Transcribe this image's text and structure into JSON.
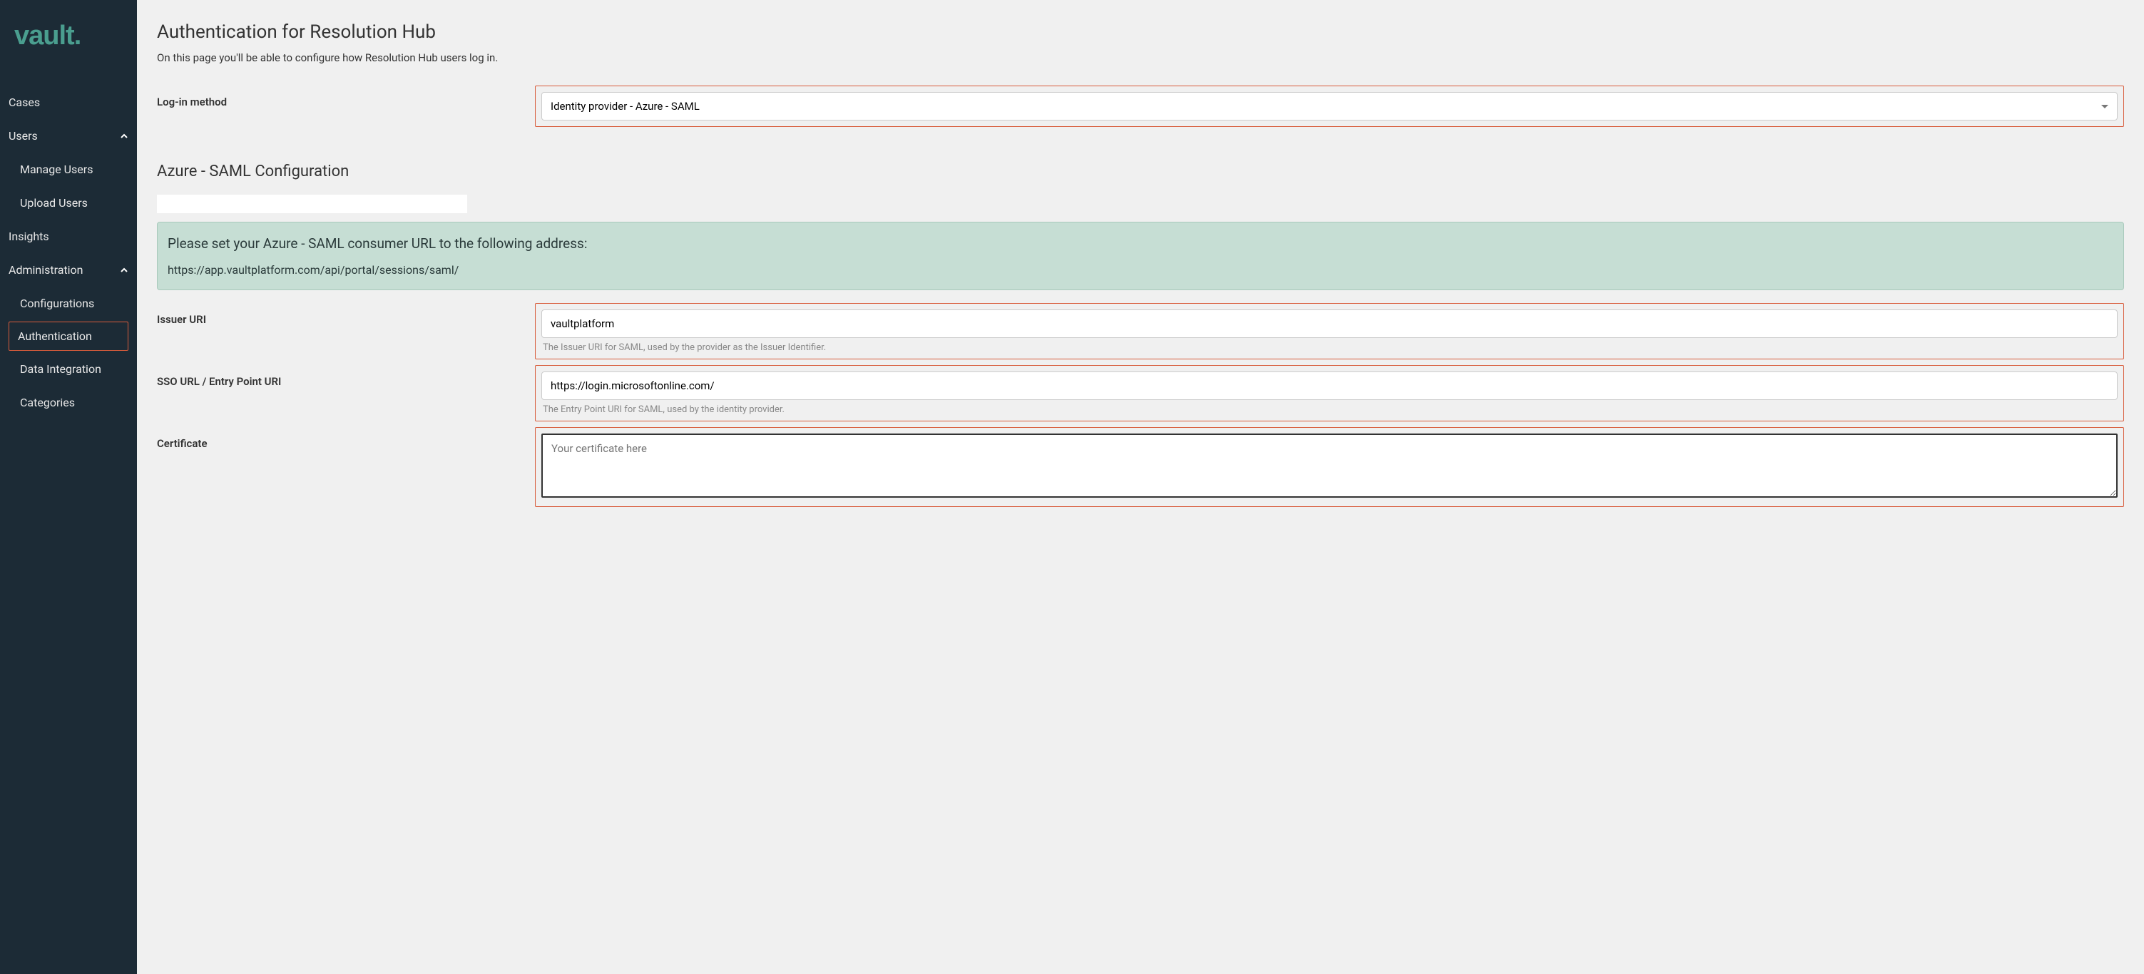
{
  "app_name": "vault.",
  "sidebar": {
    "items": [
      {
        "label": "Cases",
        "expandable": false
      },
      {
        "label": "Users",
        "expandable": true,
        "expanded": true,
        "children": [
          {
            "label": "Manage Users"
          },
          {
            "label": "Upload Users"
          }
        ]
      },
      {
        "label": "Insights",
        "expandable": false
      },
      {
        "label": "Administration",
        "expandable": true,
        "expanded": true,
        "children": [
          {
            "label": "Configurations"
          },
          {
            "label": "Authentication",
            "active": true
          },
          {
            "label": "Data Integration"
          },
          {
            "label": "Categories"
          }
        ]
      }
    ]
  },
  "page": {
    "title": "Authentication for Resolution Hub",
    "description": "On this page you'll be able to configure how Resolution Hub users log in."
  },
  "form": {
    "login_method": {
      "label": "Log-in method",
      "value": "Identity provider - Azure - SAML"
    },
    "section_title": "Azure - SAML Configuration",
    "info_box": {
      "title": "Please set your Azure - SAML consumer URL to the following address:",
      "url": "https://app.vaultplatform.com/api/portal/sessions/saml/"
    },
    "issuer_uri": {
      "label": "Issuer URI",
      "value": "vaultplatform",
      "helper": "The Issuer URI for SAML, used by the provider as the Issuer Identifier."
    },
    "sso_url": {
      "label": "SSO URL / Entry Point URI",
      "value": "https://login.microsoftonline.com/",
      "helper": "The Entry Point URI for SAML, used by the identity provider."
    },
    "certificate": {
      "label": "Certificate",
      "placeholder": "Your certificate here"
    }
  }
}
